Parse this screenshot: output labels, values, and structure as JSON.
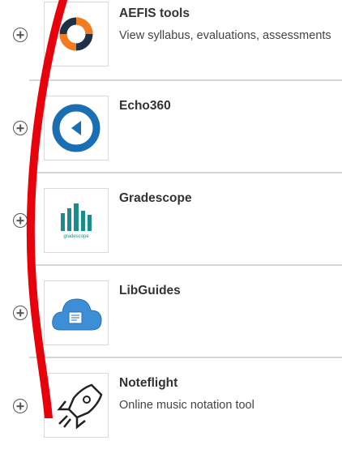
{
  "tools": [
    {
      "name": "AEFIS tools",
      "description": "View syllabus, evaluations, assessments",
      "icon": "aefis-ring-icon"
    },
    {
      "name": "Echo360",
      "description": "",
      "icon": "echo360-play-icon"
    },
    {
      "name": "Gradescope",
      "description": "",
      "icon": "gradescope-bars-icon",
      "logo_text": "gradescope"
    },
    {
      "name": "LibGuides",
      "description": "",
      "icon": "libguides-cloud-icon"
    },
    {
      "name": "Noteflight",
      "description": "Online music notation tool",
      "icon": "noteflight-rocket-icon"
    }
  ],
  "colors": {
    "annotation_stroke": "#e8000a",
    "aefis_dark": "#1f3147",
    "aefis_orange": "#f47b20",
    "echo360_blue": "#1a6fb3",
    "gradescope_teal": "#1a8c8c",
    "libguides_blue": "#3c8fd6"
  }
}
